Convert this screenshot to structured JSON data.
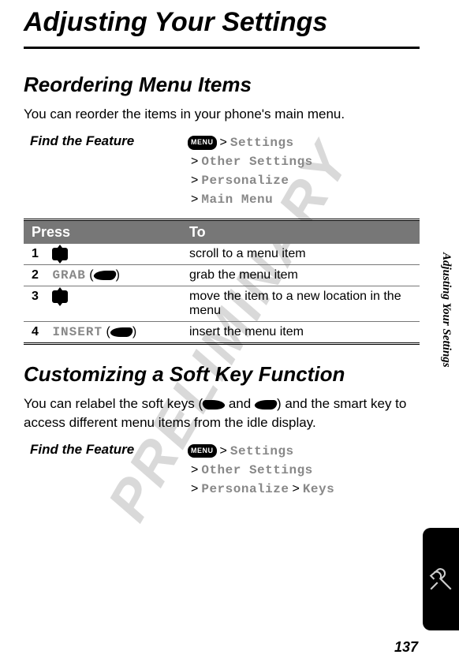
{
  "watermark": "PRELIMINARY",
  "page_title": "Adjusting Your Settings",
  "section1": {
    "heading": "Reordering Menu Items",
    "intro": "You can reorder the items in your phone's main menu.",
    "feature_label": "Find the Feature",
    "menu_key": "MENU",
    "path": [
      "Settings",
      "Other Settings",
      "Personalize",
      "Main Menu"
    ]
  },
  "table": {
    "headers": {
      "press": "Press",
      "to": "To"
    },
    "rows": [
      {
        "num": "1",
        "key_type": "scroll",
        "key_label": "",
        "to": "scroll to a menu item"
      },
      {
        "num": "2",
        "key_type": "softright",
        "key_label": "GRAB",
        "to": "grab the menu item"
      },
      {
        "num": "3",
        "key_type": "scroll",
        "key_label": "",
        "to": "move the item to a new location in the menu"
      },
      {
        "num": "4",
        "key_type": "softright",
        "key_label": "INSERT",
        "to": "insert the menu item"
      }
    ]
  },
  "section2": {
    "heading": "Customizing a Soft Key Function",
    "intro_parts": {
      "a": "You can relabel the soft keys (",
      "b": " and ",
      "c": ") and the smart key to access different menu items from the idle display."
    },
    "feature_label": "Find the Feature",
    "menu_key": "MENU",
    "path": [
      "Settings",
      "Other Settings",
      "Personalize",
      "Keys"
    ]
  },
  "side_text": "Adjusting Your Settings",
  "page_number": "137"
}
